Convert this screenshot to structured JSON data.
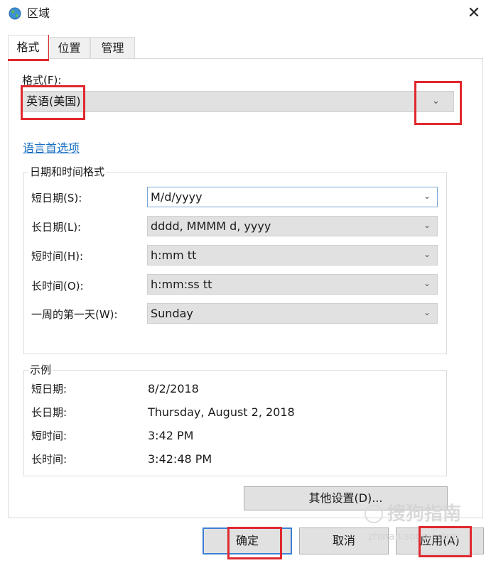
{
  "window": {
    "title": "区域",
    "close_icon": "✕"
  },
  "tabs": [
    {
      "label": "格式",
      "active": true
    },
    {
      "label": "位置",
      "active": false
    },
    {
      "label": "管理",
      "active": false
    }
  ],
  "format": {
    "label": "格式(F):",
    "value": "英语(美国)"
  },
  "language_link": "语言首选项",
  "date_time_group": {
    "title": "日期和时间格式",
    "rows": [
      {
        "label": "短日期(S):",
        "value": "M/d/yyyy"
      },
      {
        "label": "长日期(L):",
        "value": "dddd, MMMM d, yyyy"
      },
      {
        "label": "短时间(H):",
        "value": "h:mm tt"
      },
      {
        "label": "长时间(O):",
        "value": "h:mm:ss tt"
      },
      {
        "label": "一周的第一天(W):",
        "value": "Sunday"
      }
    ]
  },
  "example_group": {
    "title": "示例",
    "rows": [
      {
        "label": "短日期:",
        "value": "8/2/2018"
      },
      {
        "label": "长日期:",
        "value": "Thursday, August 2, 2018"
      },
      {
        "label": "短时间:",
        "value": "3:42 PM"
      },
      {
        "label": "长时间:",
        "value": "3:42:48 PM"
      }
    ]
  },
  "buttons": {
    "more_settings": "其他设置(D)...",
    "ok": "确定",
    "cancel": "取消",
    "apply": "应用(A)"
  },
  "chevron_glyph": "⌄",
  "watermark": {
    "text": "搜狗指南",
    "url": "zhinan.sogou.com"
  },
  "colors": {
    "annotation_red": "#e0282e",
    "link_blue": "#1a6fc0",
    "focus_blue": "#3c7fd6"
  }
}
